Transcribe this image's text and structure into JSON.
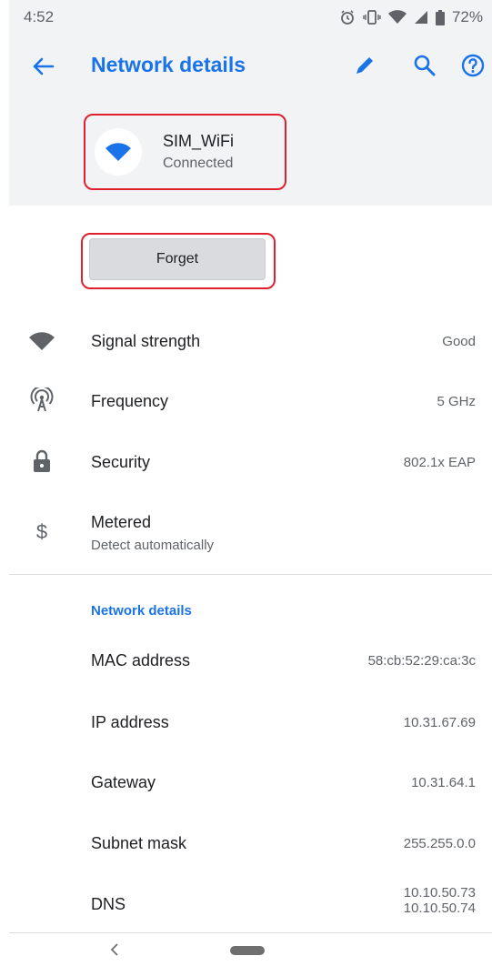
{
  "status_bar": {
    "time": "4:52",
    "battery": "72%",
    "icons": [
      "alarm-icon",
      "vibrate-icon",
      "wifi-signal-icon",
      "cell-signal-icon",
      "battery-icon"
    ]
  },
  "app_bar": {
    "title": "Network details",
    "actions": [
      "edit-icon",
      "search-icon",
      "help-icon"
    ]
  },
  "header": {
    "ssid": "SIM_WiFi",
    "status": "Connected"
  },
  "forget_button": {
    "label": "Forget"
  },
  "rows": [
    {
      "icon": "wifi-icon",
      "label": "Signal strength",
      "value": "Good"
    },
    {
      "icon": "frequency-icon",
      "label": "Frequency",
      "value": "5 GHz"
    },
    {
      "icon": "lock-icon",
      "label": "Security",
      "value": "802.1x EAP"
    },
    {
      "icon": "dollar-icon",
      "label": "Metered",
      "sub": "Detect automatically"
    }
  ],
  "section": {
    "title": "Network details",
    "items": [
      {
        "label": "MAC address",
        "value": "58:cb:52:29:ca:3c"
      },
      {
        "label": "IP address",
        "value": "10.31.67.69"
      },
      {
        "label": "Gateway",
        "value": "10.31.64.1"
      },
      {
        "label": "Subnet mask",
        "value": "255.255.0.0"
      },
      {
        "label": "DNS",
        "value": "10.10.50.73",
        "value2": "10.10.50.74"
      }
    ]
  },
  "colors": {
    "accent": "#1a73e8",
    "highlight": "#e0202c",
    "header_bg": "#f1f3f4"
  }
}
